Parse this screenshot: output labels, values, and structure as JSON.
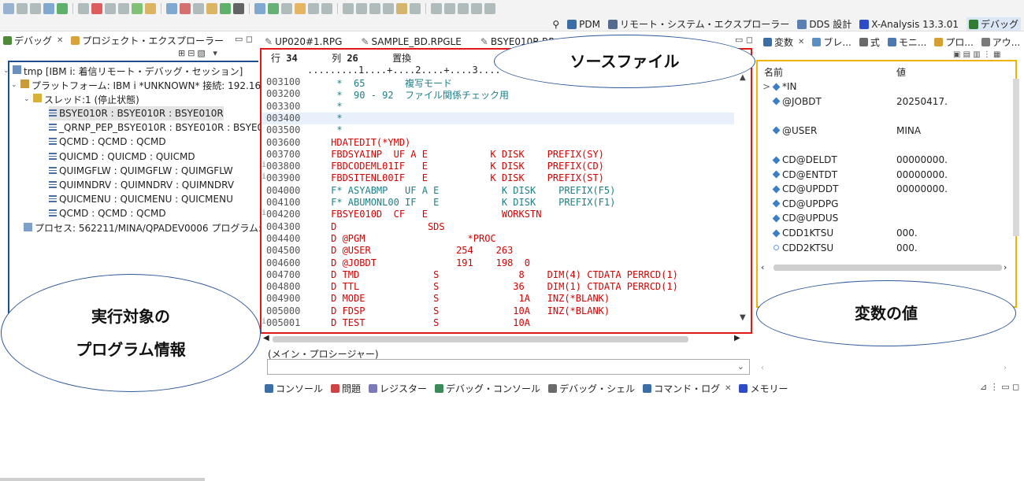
{
  "perspectives": [
    {
      "label": "PDM",
      "color": "#3a6ea5"
    },
    {
      "label": "リモート・システム・エクスプローラー",
      "color": "#556b8d"
    },
    {
      "label": "DDS 設計",
      "color": "#5b7fb0"
    },
    {
      "label": "X-Analysis 13.3.01",
      "color": "#2d4cc8"
    },
    {
      "label": "デバッグ",
      "color": "#2f7d32"
    }
  ],
  "debug_tabs": {
    "debug": "デバッグ",
    "project": "プロジェクト・エクスプローラー"
  },
  "tree": {
    "session": "tmp [IBM i: 着信リモート・デバッグ・セッション]",
    "platform": "プラットフォーム: IBM i *UNKNOWN*   接続: 192.168.10",
    "thread": "スレッド:1 (停止状態)",
    "frames": [
      "BSYE010R : BSYE010R : BSYE010R",
      "_QRNP_PEP_BSYE010R : BSYE010R : BSYE010",
      "QCMD : QCMD : QCMD",
      "QUICMD : QUICMD : QUICMD",
      "QUIMGFLW : QUIMGFLW : QUIMGFLW",
      "QUIMNDRV : QUIMNDRV : QUIMNDRV",
      "QUICMENU : QUICMENU : QUICMENU",
      "QCMD : QCMD : QCMD"
    ],
    "process": "プロセス: 562211/MINA/QPADEV0006  プログラム: BSY"
  },
  "editor_tabs": [
    "UP020#1.RPG",
    "SAMPLE_BD.RPGLE",
    "BSYE010R.RP"
  ],
  "editor": {
    "row_label": "行",
    "row_value": "34",
    "col_label": "列",
    "col_value": "26",
    "mode": "置換",
    "ruler": ".........1....+....2....+....3....",
    "lines": [
      {
        "seq": "003100",
        "cls": "c-teal",
        "code": "      *  65       複写モード"
      },
      {
        "seq": "003200",
        "cls": "c-teal",
        "code": "      *  90 - 92  ファイル関係チェック用"
      },
      {
        "seq": "003300",
        "cls": "c-teal",
        "code": "      *"
      },
      {
        "seq": "003400",
        "cls": "c-teal",
        "code": "      *"
      },
      {
        "seq": "003500",
        "cls": "c-teal",
        "code": "      *"
      },
      {
        "seq": "003600",
        "cls": "c-red",
        "code": "     HDATEDIT(*YMD)"
      },
      {
        "seq": "003700",
        "cls": "c-red",
        "code": "     FBDSYAINP  UF A E           K DISK    PREFIX(SY)"
      },
      {
        "seq": "003800",
        "cls": "c-red",
        "code": "     FBDCODEML01IF   E           K DISK    PREFIX(CD)"
      },
      {
        "seq": "003900",
        "cls": "c-red",
        "code": "     FBDSITENL00IF   E           K DISK    PREFIX(ST)"
      },
      {
        "seq": "004000",
        "cls": "c-teal",
        "code": "     F* ASYABMP   UF A E           K DISK    PREFIX(F5)"
      },
      {
        "seq": "004100",
        "cls": "c-teal",
        "code": "     F* ABUMONL00 IF   E           K DISK    PREFIX(F1)"
      },
      {
        "seq": "004200",
        "cls": "c-red",
        "code": "     FBSYE010D  CF   E             WORKSTN"
      },
      {
        "seq": "004300",
        "cls": "c-red",
        "code": "     D                SDS"
      },
      {
        "seq": "004400",
        "cls": "c-red",
        "code": "     D @PGM                  *PROC"
      },
      {
        "seq": "004500",
        "cls": "c-red",
        "code": "     D @USER               254    263"
      },
      {
        "seq": "004600",
        "cls": "c-red",
        "code": "     D @JOBDT              191    198  0"
      },
      {
        "seq": "004700",
        "cls": "c-red",
        "code": "     D TMD             S              8    DIM(4) CTDATA PERRCD(1)"
      },
      {
        "seq": "004800",
        "cls": "c-red",
        "code": "     D TTL             S             36    DIM(1) CTDATA PERRCD(1)"
      },
      {
        "seq": "004900",
        "cls": "c-red",
        "code": "     D MODE            S              1A   INZ(*BLANK)"
      },
      {
        "seq": "005000",
        "cls": "c-red",
        "code": "     D FDSP            S             10A   INZ(*BLANK)"
      },
      {
        "seq": "005001",
        "cls": "c-red",
        "code": "     D TEST            S             10A"
      }
    ]
  },
  "procedure": {
    "label": "(メイン・プロシージャー)",
    "value": ""
  },
  "console_tabs": [
    "コンソール",
    "問題",
    "レジスター",
    "デバッグ・コンソール",
    "デバッグ・シェル",
    "コマンド・ログ",
    "メモリー"
  ],
  "var_tabs": [
    "変数",
    "ブレ...",
    "式",
    "モニ...",
    "プロ...",
    "アウ..."
  ],
  "variables": {
    "col_name": "名前",
    "col_value": "値",
    "rows": [
      {
        "name": "*IN",
        "value": "",
        "expand": ">",
        "icon": "diamond"
      },
      {
        "name": "@JOBDT",
        "value": "20250417.",
        "expand": "",
        "icon": "diamond"
      },
      {
        "name": "",
        "value": "",
        "expand": "",
        "icon": ""
      },
      {
        "name": "@USER",
        "value": "MINA",
        "expand": "",
        "icon": "diamond"
      },
      {
        "name": "",
        "value": "",
        "expand": "",
        "icon": ""
      },
      {
        "name": "CD@DELDT",
        "value": "00000000.",
        "expand": "",
        "icon": "diamond"
      },
      {
        "name": "CD@ENTDT",
        "value": "00000000.",
        "expand": "",
        "icon": "diamond"
      },
      {
        "name": "CD@UPDDT",
        "value": "00000000.",
        "expand": "",
        "icon": "diamond"
      },
      {
        "name": "CD@UPDPG",
        "value": "",
        "expand": "",
        "icon": "diamond"
      },
      {
        "name": "CD@UPDUS",
        "value": "",
        "expand": "",
        "icon": "diamond"
      },
      {
        "name": "CDD1KTSU",
        "value": "000.",
        "expand": "",
        "icon": "diamond"
      },
      {
        "name": "CDD2KTSU",
        "value": "000.",
        "expand": "",
        "icon": "circle"
      }
    ]
  },
  "annotations": {
    "source": "ソースファイル",
    "program_line1": "実行対象の",
    "program_line2": "プログラム情報",
    "values": "変数の値"
  }
}
